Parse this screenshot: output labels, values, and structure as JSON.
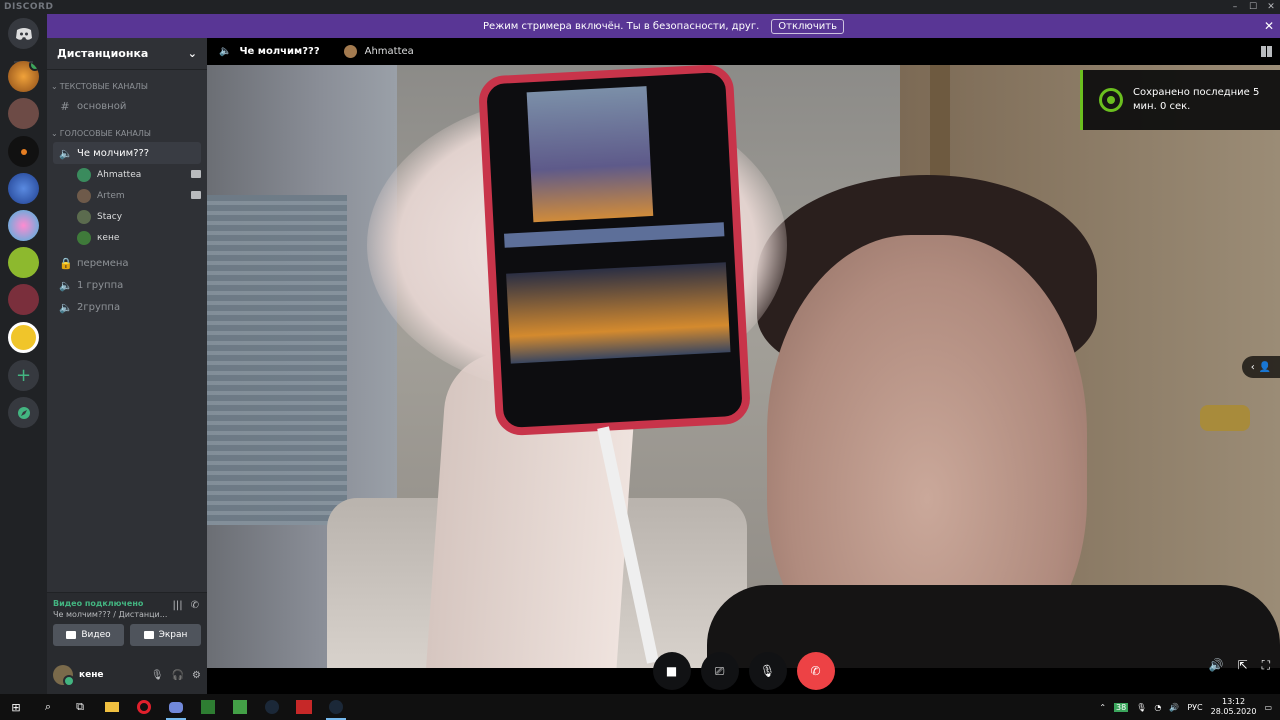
{
  "app": {
    "brand": "DISCORD"
  },
  "window_controls": {
    "minimize": "–",
    "maximize": "☐",
    "close": "✕"
  },
  "banner": {
    "text": "Режим стримера включён. Ты в безопасности, друг.",
    "button": "Отключить",
    "close": "✕"
  },
  "server": {
    "name": "Дистанционка",
    "chevron": "⌄"
  },
  "categories": {
    "text": "ТЕКСТОВЫЕ КАНАЛЫ",
    "voice": "ГОЛОСОВЫЕ КАНАЛЫ"
  },
  "channels": {
    "text": [
      {
        "name": "основной"
      }
    ],
    "voice_active": {
      "name": "Че молчим???"
    },
    "members": [
      {
        "name": "Ahmattea",
        "camera": true,
        "dim": false
      },
      {
        "name": "Artem",
        "camera": true,
        "dim": true
      },
      {
        "name": "Stacy",
        "camera": false,
        "dim": false
      },
      {
        "name": "кене",
        "camera": false,
        "dim": false
      }
    ],
    "other": [
      {
        "name": "перемена",
        "icon": "lock-icon"
      },
      {
        "name": "1 группа",
        "icon": "speaker-icon"
      },
      {
        "name": "2группа",
        "icon": "speaker-icon"
      }
    ]
  },
  "voice_panel": {
    "status": "Видео подключено",
    "channel": "Че молчим??? / Дистанци...",
    "video_btn": "Видео",
    "screen_btn": "Экран"
  },
  "user": {
    "name": "кене"
  },
  "video": {
    "channel_title": "Че молчим???",
    "participant": "Ahmattea"
  },
  "overlay": {
    "text": "Сохранено последние 5 мин. 0 сек."
  },
  "taskbar": {
    "time": "13:12",
    "date": "28.05.2020",
    "lang": "РУС",
    "battery_badge": "38"
  },
  "colors": {
    "banner": "#593695",
    "accent_green": "#6bbf1f",
    "hangup": "#ed4245",
    "online": "#43b581"
  }
}
